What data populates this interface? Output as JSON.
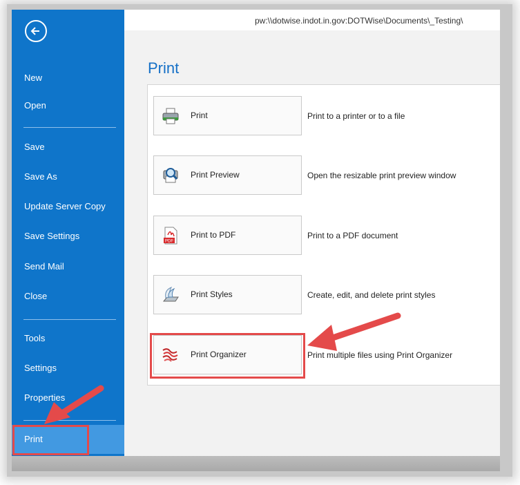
{
  "address_path": "pw:\\\\dotwise.indot.in.gov:DOTWise\\Documents\\_Testing\\",
  "sidebar": {
    "items": [
      {
        "label": "New"
      },
      {
        "label": "Open"
      },
      {
        "label": "Save"
      },
      {
        "label": "Save As"
      },
      {
        "label": "Update Server Copy"
      },
      {
        "label": "Save Settings"
      },
      {
        "label": "Send Mail"
      },
      {
        "label": "Close"
      },
      {
        "label": "Tools"
      },
      {
        "label": "Settings"
      },
      {
        "label": "Properties"
      },
      {
        "label": "Print"
      }
    ],
    "active": "Print",
    "back_icon": "back-arrow-circle-icon"
  },
  "main": {
    "title": "Print",
    "commands": [
      {
        "label": "Print",
        "description": "Print to a printer or to a file",
        "icon": "printer-icon"
      },
      {
        "label": "Print Preview",
        "description": "Open the resizable print preview window",
        "icon": "print-preview-icon"
      },
      {
        "label": "Print to PDF",
        "description": "Print to a PDF document",
        "icon": "pdf-icon"
      },
      {
        "label": "Print Styles",
        "description": "Create, edit, and delete print styles",
        "icon": "print-styles-icon"
      },
      {
        "label": "Print Organizer",
        "description": "Print multiple files using Print Organizer",
        "icon": "print-organizer-icon"
      }
    ]
  },
  "colors": {
    "sidebar": "#0f75ca",
    "sidebar_active": "#4299e1",
    "title": "#1570c7",
    "annotation_red": "#e44a4a"
  }
}
